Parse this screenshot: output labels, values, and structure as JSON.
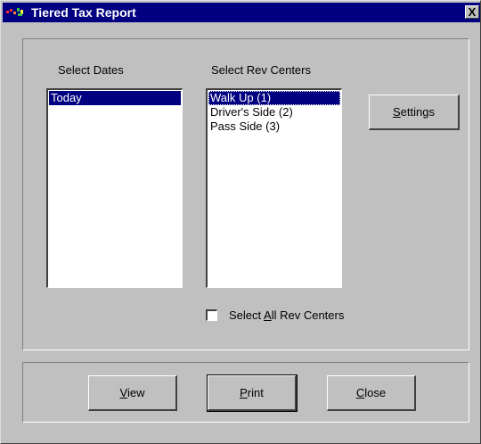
{
  "window": {
    "title": "Tiered Tax Report",
    "close_glyph": "X"
  },
  "dates": {
    "label": "Select Dates",
    "items": [
      "Today"
    ],
    "selected": "Today"
  },
  "rev_centers": {
    "label": "Select Rev Centers",
    "items": [
      "Walk Up (1)",
      "Driver's Side (2)",
      "Pass Side (3)"
    ],
    "selected": "Walk Up (1)"
  },
  "settings_button": {
    "accel": "S",
    "rest": "ettings"
  },
  "select_all": {
    "pre": "Select ",
    "accel": "A",
    "rest": "ll Rev Centers",
    "checked": false
  },
  "buttons": {
    "view": {
      "accel": "V",
      "rest": "iew"
    },
    "print": {
      "accel": "P",
      "rest": "rint"
    },
    "close": {
      "accel": "C",
      "rest": "lose"
    }
  },
  "colors": {
    "title_bar": "#000080",
    "dialog_face": "#c0c0c0",
    "selection": "#000080"
  }
}
